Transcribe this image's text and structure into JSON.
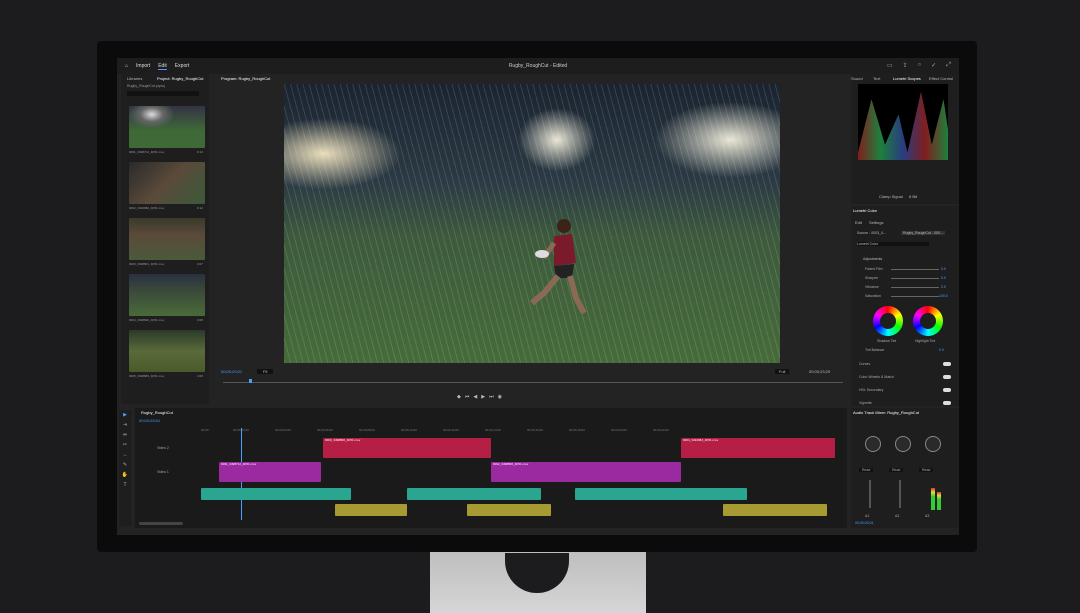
{
  "app": {
    "tabs": [
      "Import",
      "Edit",
      "Export"
    ],
    "title": "Rugby_RoughCut - Edited"
  },
  "project": {
    "tab_libraries": "Libraries",
    "tab_project": "Project: Rugby_RoughCut",
    "bin": "Rugby_RoughCut.prproj",
    "clips": [
      {
        "name": "0001_3498712_4K51.mov",
        "dur": "0:13"
      },
      {
        "name": "0002_3432984_4K51.mov",
        "dur": "0:12"
      },
      {
        "name": "0003_3498801_4K51.mov",
        "dur": "0:07"
      },
      {
        "name": "0004_3498822_4K51.mov",
        "dur": "0:08"
      },
      {
        "name": "0005_3498883_4K51.mov",
        "dur": "4:08"
      }
    ]
  },
  "program": {
    "tab": "Program: Rugby_RoughCut",
    "timecode_left": "00;00;03;01",
    "zoom": "Fit",
    "quality": "Full",
    "timecode_right": "00;00;23;29"
  },
  "scopes": {
    "tabs": [
      "Sound",
      "Text",
      "Lumetri Scopes",
      "Effect Control"
    ],
    "mode": "Clamp Signal",
    "bits": "8 Bit"
  },
  "lumetri": {
    "tab": "Lumetri Color",
    "sub_tabs": [
      "Edit",
      "Settings"
    ],
    "source": "Source - 0003_4...",
    "target": "Rugby_RoughCut - 000...",
    "effect": "Lumetri Color",
    "section": "Adjustments",
    "sliders": [
      {
        "label": "Faded Film",
        "value": "0.0"
      },
      {
        "label": "Sharpen",
        "value": "0.0"
      },
      {
        "label": "Vibrance",
        "value": "0.0"
      },
      {
        "label": "Saturation",
        "value": "100.0"
      }
    ],
    "wheel_left": "Shadow Tint",
    "wheel_right": "Highlight Tint",
    "tint_balance": "Tint Balance",
    "tint_value": "0.0",
    "sections": [
      "Curves",
      "Color Wheels & Match",
      "HSL Secondary",
      "Vignette"
    ]
  },
  "timeline": {
    "tab": "Rugby_RoughCut",
    "timecode": "00;00;03;01",
    "ruler": [
      "00;00",
      "00;00;02;00",
      "00;00;04;00",
      "00;00;06;00",
      "00;00;08;00",
      "00;00;10;00",
      "00;00;12;00",
      "00;00;14;00",
      "00;00;16;00",
      "00;00;18;00",
      "00;00;20;00",
      "00;00;22;00"
    ],
    "v2": [
      {
        "label": "0003_3498800_4K51.mov"
      },
      {
        "label": "0004_3432984_4K51.mov"
      }
    ],
    "v1": [
      {
        "label": "0001_3498712_4K51.mov"
      },
      {
        "label": "0002_3498806_4K51.mov"
      }
    ],
    "track_v2": "Video 2",
    "track_v1": "Video 1"
  },
  "mixer": {
    "tab": "Audio Track Mixer: Rugby_RoughCut",
    "read": [
      "Read",
      "Read",
      "Read"
    ],
    "channels": [
      "A1",
      "A2",
      "A3"
    ],
    "timecode": "00;00;03;01"
  }
}
